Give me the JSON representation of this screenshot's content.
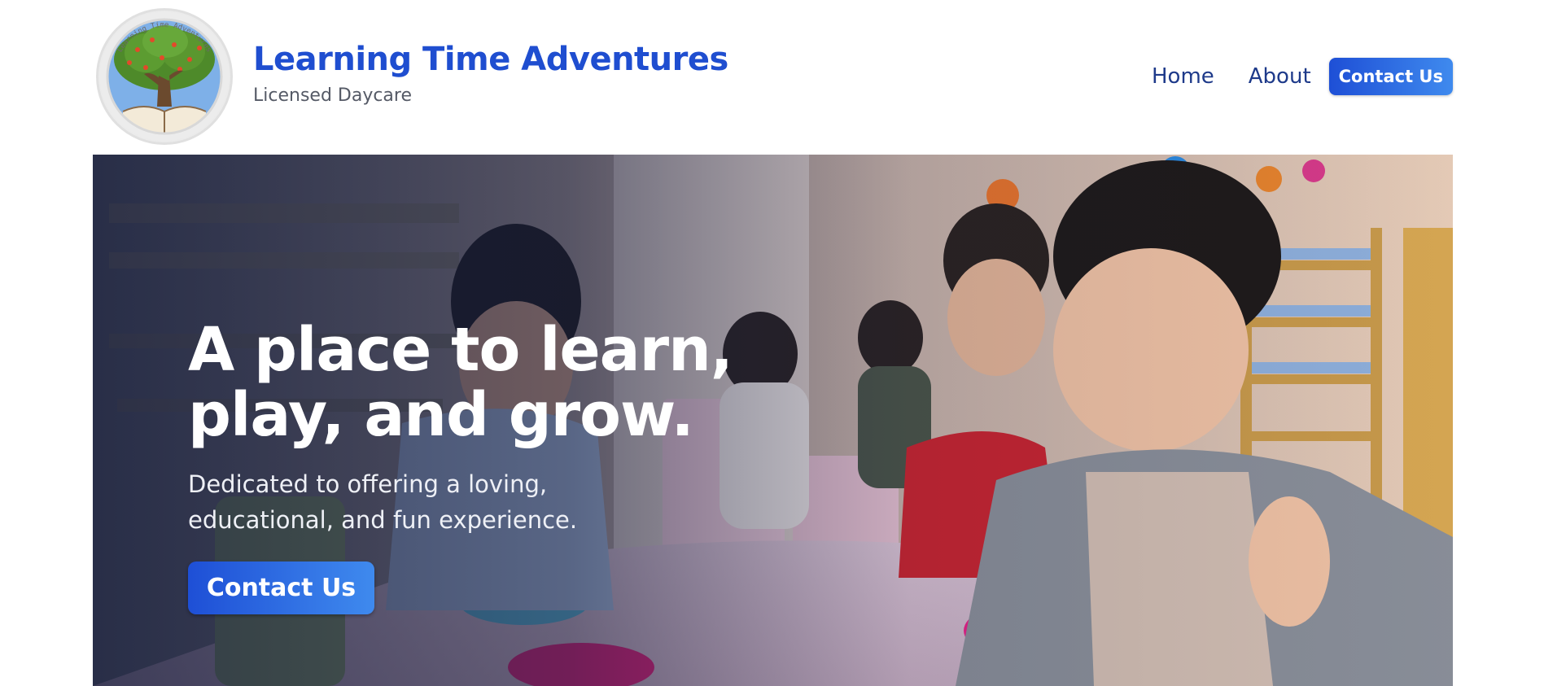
{
  "header": {
    "logo": {
      "icon": "tree-book-logo",
      "ring_text": "Learning Time Adventures"
    },
    "title": "Learning Time Adventures",
    "subtitle": "Licensed Daycare"
  },
  "nav": {
    "items": [
      {
        "label": "Home"
      },
      {
        "label": "About"
      }
    ],
    "cta_label": "Contact Us"
  },
  "hero": {
    "heading_line1": "A place to learn,",
    "heading_line2": "play, and grow.",
    "subtext_line1": "Dedicated to offering a loving,",
    "subtext_line2": "educational, and fun experience.",
    "cta_label": "Contact Us",
    "image": "children-eating-at-daycare-table-photo"
  },
  "colors": {
    "brand_blue": "#1f4ed0",
    "nav_text": "#1e3a8a",
    "cta_gradient_start": "#1e4fd6",
    "cta_gradient_end": "#3f8aee"
  }
}
